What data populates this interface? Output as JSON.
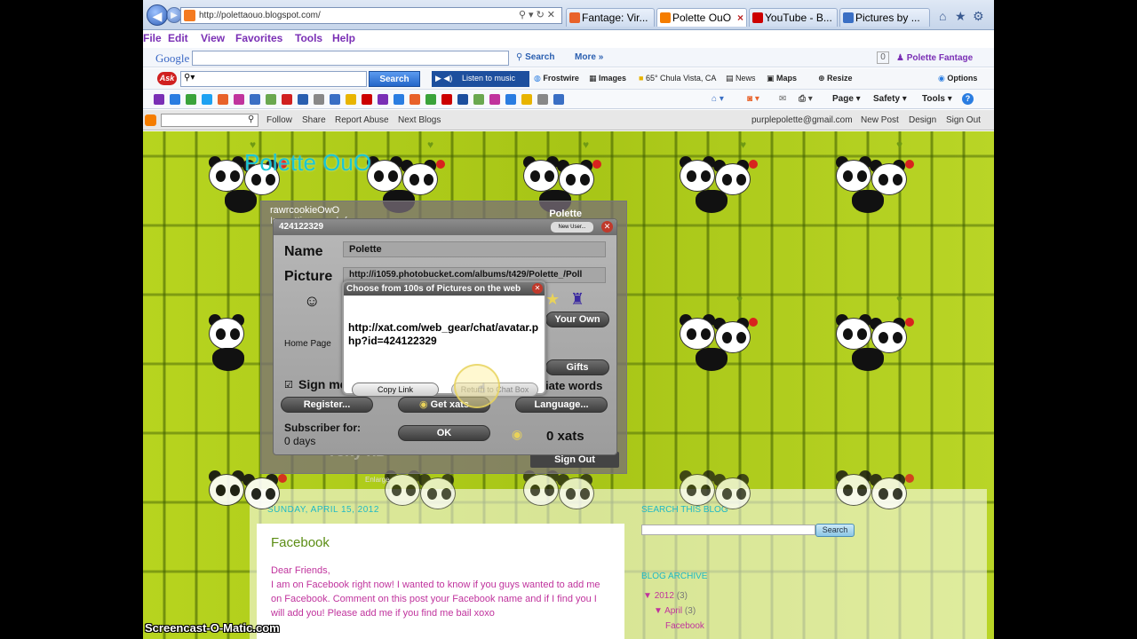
{
  "browser": {
    "address_url": "http://polettaouo.blogspot.com/",
    "address_controls": "⚲▾↻✕",
    "tabs": [
      {
        "label": "Fantage: Vir...",
        "fav_color": "#e8622a"
      },
      {
        "label": "Polette OuO",
        "fav_color": "#f57d00"
      },
      {
        "label": "YouTube - B...",
        "fav_color": "#cc0000"
      },
      {
        "label": "Pictures by ...",
        "fav_color": "#3a6fc4"
      }
    ],
    "back_glyph": "◀",
    "forward_glyph": "▶",
    "home_icon": "⌂",
    "favorites_icon": "★",
    "settings_icon": "⚙"
  },
  "menubar": {
    "items": [
      "File",
      "Edit",
      "View",
      "Favorites",
      "Tools",
      "Help"
    ]
  },
  "google_toolbar": {
    "logo": "Google",
    "search_label": "Search",
    "more_label": "More",
    "badge": "0",
    "user": "Polette Fantage",
    "more_arrow": "»"
  },
  "ask_toolbar": {
    "logo": "Ask",
    "search_button": "Search",
    "listen_label": "Listen to music",
    "items": [
      "Frostwire",
      "Images",
      "65° Chula Vista, CA",
      "News",
      "Maps",
      "Resize"
    ],
    "options_label": "Options"
  },
  "command_bar": {
    "page_label": "Page",
    "safety_label": "Safety",
    "tools_label": "Tools",
    "help_glyph": "?"
  },
  "blogger_nav": {
    "links": [
      "Follow",
      "Share",
      "Report Abuse",
      "Next Blogs"
    ],
    "email": "purplepolette@gmail.com",
    "right_links": [
      "New Post",
      "Design",
      "Sign Out"
    ]
  },
  "blog": {
    "title": "Polette OuO",
    "post": {
      "date": "SUNDAY, APRIL 15, 2012",
      "title": "Facebook",
      "body": "Dear Friends,\nI am on Facebook right now! I wanted to know if you guys wanted to add me on Facebook. Comment on this post your Facebook name and if I find you I will add you! Please add me if you find me bail xoxo"
    },
    "sidebar": {
      "search_title": "SEARCH THIS BLOG",
      "search_button": "Search",
      "archive_title": "BLOG ARCHIVE",
      "archive_year": "2012",
      "archive_year_count": "(3)",
      "archive_month": "April",
      "archive_month_count": "(3)",
      "archive_post": "Facebook"
    }
  },
  "chat_box": {
    "user_line_1": "rawrcookieOwO",
    "user_line_2": "Im gettin on web from",
    "polette_label": "Polette",
    "sign_out": "Sign Out",
    "bg_text": "rcky xD",
    "enlarge": "Enlarge"
  },
  "profile_dialog": {
    "id": "424122329",
    "new_user": "New User...",
    "name_label": "Name",
    "name_value": "Polette",
    "picture_label": "Picture",
    "picture_value": "http://i1059.photobucket.com/albums/t429/Polette_/Poll",
    "home_page_label": "Home Page",
    "your_own": "Your Own",
    "gifts": "Gifts",
    "sign_me_label": "Sign me",
    "filter_words": "iate words",
    "register": "Register...",
    "get_xats": "Get xats",
    "language": "Language...",
    "subscriber_label": "Subscriber for:",
    "subscriber_value": "0 days",
    "ok": "OK",
    "xats": "0 xats"
  },
  "popup": {
    "title": "Choose from 100s of Pictures on the web",
    "link": "http://xat.com/web_gear/chat/avatar.php?id=424122329",
    "copy_link": "Copy Link",
    "return": "Return to Chat Box"
  },
  "watermark": "Screencast-O-Matic.com"
}
